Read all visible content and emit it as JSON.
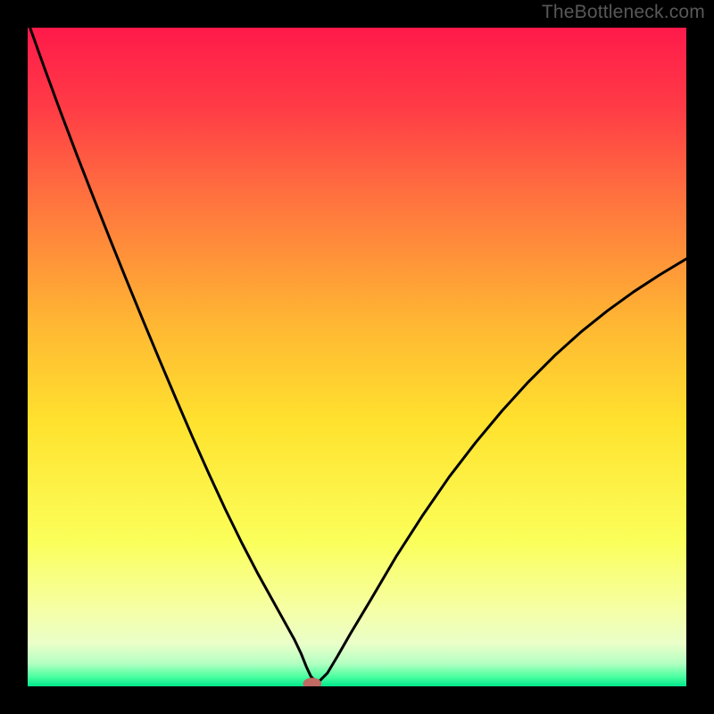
{
  "watermark": "TheBottleneck.com",
  "chart_data": {
    "type": "line",
    "title": "",
    "xlabel": "",
    "ylabel": "",
    "xlim": [
      0,
      100
    ],
    "ylim": [
      0,
      100
    ],
    "grid": false,
    "legend": false,
    "background": {
      "type": "vertical-gradient",
      "stops": [
        {
          "pos": 0.0,
          "color": "#ff1a4a"
        },
        {
          "pos": 0.12,
          "color": "#ff3b46"
        },
        {
          "pos": 0.25,
          "color": "#ff6f3f"
        },
        {
          "pos": 0.45,
          "color": "#ffb733"
        },
        {
          "pos": 0.6,
          "color": "#ffe22e"
        },
        {
          "pos": 0.78,
          "color": "#fbff5a"
        },
        {
          "pos": 0.88,
          "color": "#f6ffa3"
        },
        {
          "pos": 0.935,
          "color": "#eaffc9"
        },
        {
          "pos": 0.965,
          "color": "#b4ffc2"
        },
        {
          "pos": 0.985,
          "color": "#4dffa0"
        },
        {
          "pos": 1.0,
          "color": "#00e88c"
        }
      ]
    },
    "series": [
      {
        "name": "bottleneck-curve",
        "color": "#000000",
        "x": [
          0.0,
          2.5,
          5.0,
          7.5,
          10.0,
          12.5,
          15.0,
          17.5,
          20.0,
          22.5,
          25.0,
          27.5,
          30.0,
          32.5,
          35.0,
          37.5,
          39.0,
          40.5,
          41.5,
          42.3,
          43.0,
          44.0,
          45.5,
          47.0,
          49.0,
          52.0,
          56.0,
          60.0,
          64.0,
          68.0,
          72.0,
          76.0,
          80.0,
          84.0,
          88.0,
          92.0,
          96.0,
          100.0
        ],
        "y": [
          101.0,
          94.0,
          87.2,
          80.6,
          74.2,
          67.9,
          61.7,
          55.6,
          49.6,
          43.7,
          37.9,
          32.3,
          26.9,
          21.8,
          17.0,
          12.5,
          9.8,
          7.1,
          5.0,
          3.0,
          1.5,
          0.5,
          2.0,
          4.5,
          8.0,
          13.0,
          19.8,
          26.0,
          31.8,
          37.0,
          41.8,
          46.2,
          50.2,
          53.8,
          57.0,
          59.9,
          62.5,
          64.9
        ]
      }
    ],
    "marker": {
      "x": 43.2,
      "y": 0.4,
      "rx": 1.4,
      "ry": 0.9,
      "color": "#c06a63"
    }
  }
}
